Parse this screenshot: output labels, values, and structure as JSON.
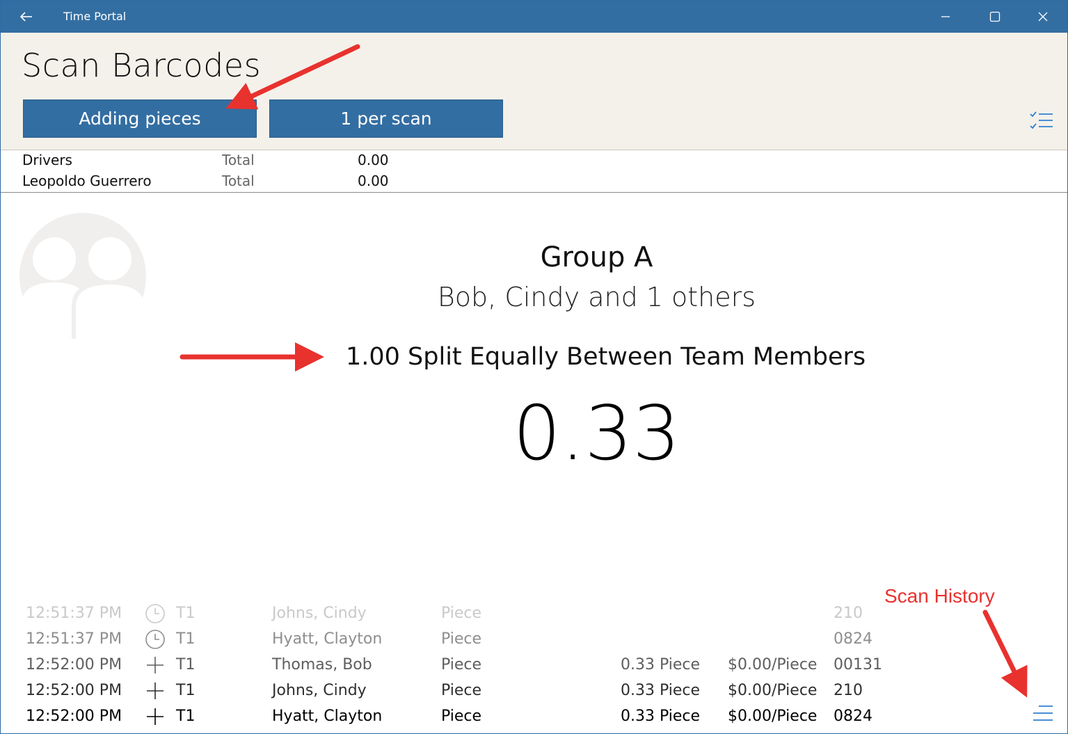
{
  "window": {
    "title": "Time Portal"
  },
  "header": {
    "page_title": "Scan Barcodes",
    "mode_button": "Adding pieces",
    "rate_button": "1 per scan"
  },
  "totals": [
    {
      "name": "Drivers",
      "label": "Total",
      "value": "0.00"
    },
    {
      "name": "Leopoldo Guerrero",
      "label": "Total",
      "value": "0.00"
    }
  ],
  "main": {
    "group_name": "Group A",
    "group_members": "Bob, Cindy and 1 others",
    "split_text": "1.00 Split Equally Between Team Members",
    "value": "0.33"
  },
  "history": [
    {
      "time": "12:51:37 PM",
      "icon": "clock-icon",
      "terminal": "T1",
      "name": "Johns, Cindy",
      "type": "Piece",
      "qty": "",
      "rate": "",
      "code": "210"
    },
    {
      "time": "12:51:37 PM",
      "icon": "clock-icon",
      "terminal": "T1",
      "name": "Hyatt, Clayton",
      "type": "Piece",
      "qty": "",
      "rate": "",
      "code": "0824"
    },
    {
      "time": "12:52:00 PM",
      "icon": "plus-icon",
      "terminal": "T1",
      "name": "Thomas, Bob",
      "type": "Piece",
      "qty": "0.33 Piece",
      "rate": "$0.00/Piece",
      "code": "00131"
    },
    {
      "time": "12:52:00 PM",
      "icon": "plus-icon",
      "terminal": "T1",
      "name": "Johns, Cindy",
      "type": "Piece",
      "qty": "0.33 Piece",
      "rate": "$0.00/Piece",
      "code": "210"
    },
    {
      "time": "12:52:00 PM",
      "icon": "plus-icon",
      "terminal": "T1",
      "name": "Hyatt, Clayton",
      "type": "Piece",
      "qty": "0.33 Piece",
      "rate": "$0.00/Piece",
      "code": "0824"
    }
  ],
  "annotations": {
    "scan_history_label": "Scan History"
  },
  "colors": {
    "accent": "#336ea2",
    "header_bg": "#f4f1ea",
    "annotation": "#e8322e"
  }
}
